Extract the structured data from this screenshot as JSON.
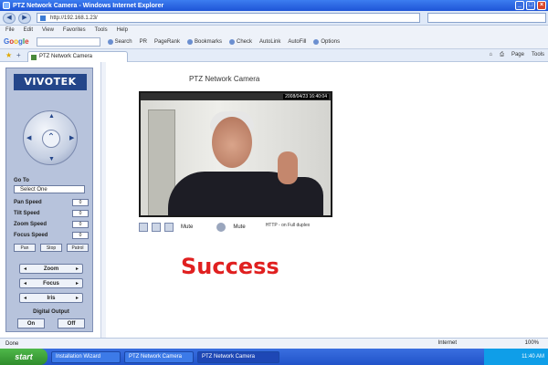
{
  "window": {
    "title": "PTZ Network Camera - Windows Internet Explorer",
    "buttons": [
      "_",
      "□",
      "×"
    ]
  },
  "address": {
    "url": "http://192.168.1.23/"
  },
  "menu": [
    "File",
    "Edit",
    "View",
    "Favorites",
    "Tools",
    "Help"
  ],
  "toolbar": {
    "google": "Google",
    "items": [
      "Search",
      "PR",
      "PageRank",
      "Bookmarks",
      "Check",
      "AutoLink",
      "AutoFill",
      "Options"
    ]
  },
  "tab": {
    "title": "PTZ Network Camera",
    "tools": [
      "Page",
      "Tools"
    ]
  },
  "sidebar": {
    "logo": "VIVOTEK",
    "goto_label": "Go To",
    "goto_select": "Select One",
    "speeds": [
      {
        "label": "Pan Speed",
        "value": "0"
      },
      {
        "label": "Tilt Speed",
        "value": "0"
      },
      {
        "label": "Zoom Speed",
        "value": "0"
      },
      {
        "label": "Focus Speed",
        "value": "0"
      }
    ],
    "mini_buttons": [
      "Pan",
      "Stop",
      "Patrol"
    ],
    "controls": [
      "Zoom",
      "Focus",
      "Iris"
    ],
    "digital_output_label": "Digital Output",
    "do_on": "On",
    "do_off": "Off"
  },
  "main": {
    "page_title": "PTZ Network Camera",
    "timestamp": "2008/04/23 16:40:04",
    "video_tools": {
      "mute1": "Mute",
      "mute2": "Mute",
      "info": "HTTP - on Full duplex"
    },
    "status_message": "Success"
  },
  "statusbar": {
    "left": "Done",
    "zone": "Internet",
    "zoom": "100%"
  },
  "taskbar": {
    "start": "start",
    "tasks": [
      "Installation Wizard",
      "PTZ Network Camera",
      "PTZ Network Camera"
    ],
    "clock": "11:40 AM"
  }
}
